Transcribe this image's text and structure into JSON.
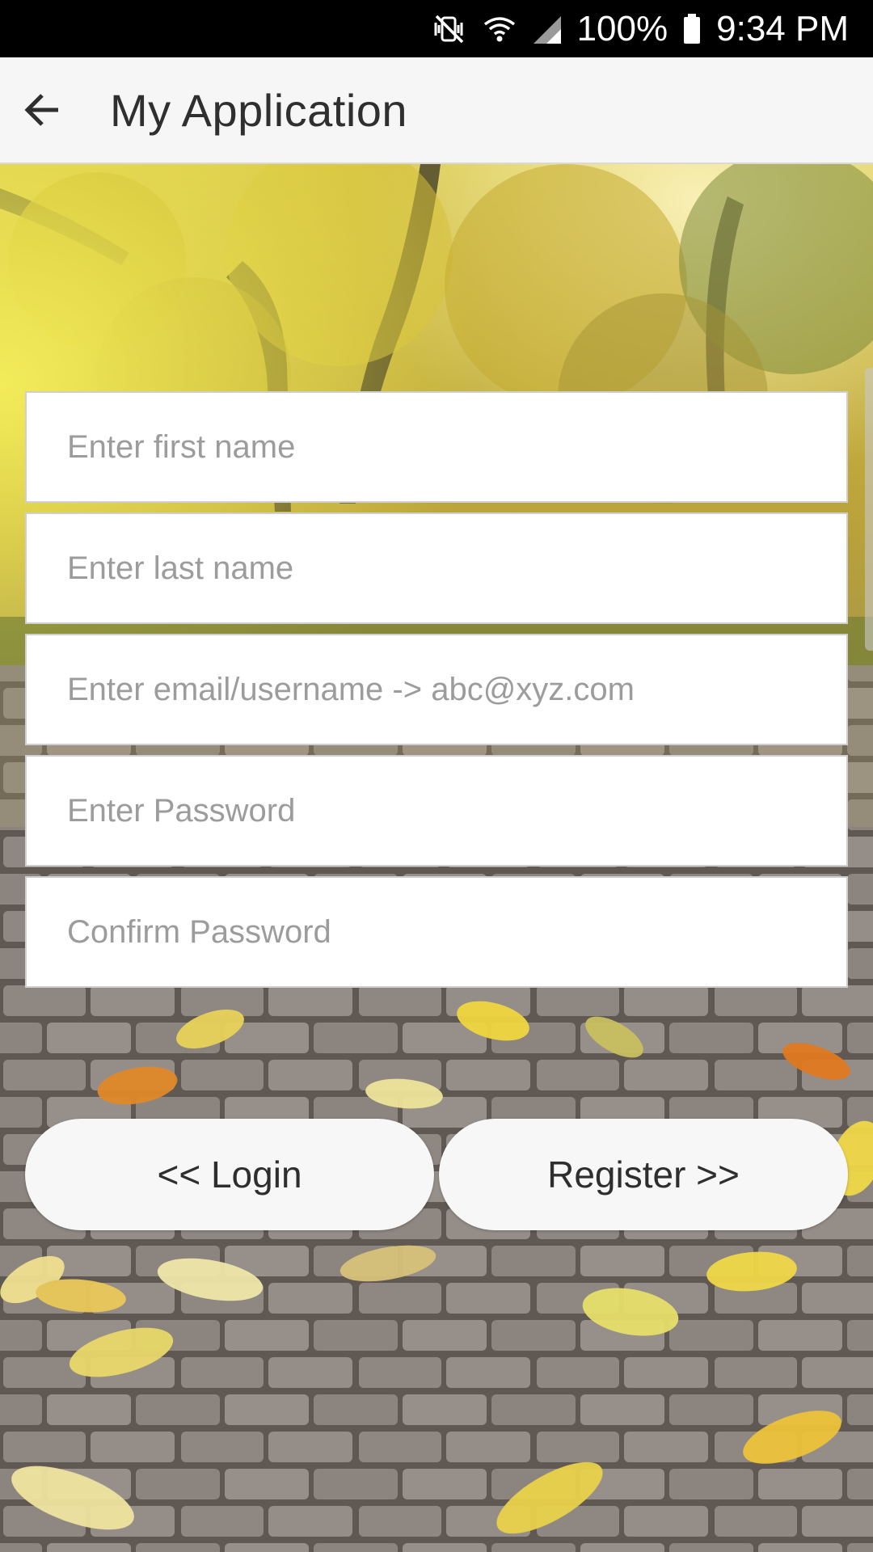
{
  "status_bar": {
    "battery": "100%",
    "time": "9:34 PM",
    "icons": [
      "mute-vibrate-icon",
      "wifi-icon",
      "cell-signal-icon",
      "battery-icon"
    ]
  },
  "app_bar": {
    "title": "My Application",
    "back_icon": "arrow-back-icon"
  },
  "form": {
    "first_name_placeholder": "Enter first name",
    "last_name_placeholder": "Enter last name",
    "email_placeholder": "Enter email/username -> abc@xyz.com",
    "password_placeholder": "Enter Password",
    "confirm_password_placeholder": "Confirm Password"
  },
  "buttons": {
    "login_label": "<< Login",
    "register_label": "Register >>"
  },
  "colors": {
    "status_bar_bg": "#000000",
    "app_bar_bg": "#f6f6f6",
    "field_bg": "#ffffff",
    "button_bg": "#f7f7f7",
    "placeholder_text": "#9c9c9c"
  }
}
